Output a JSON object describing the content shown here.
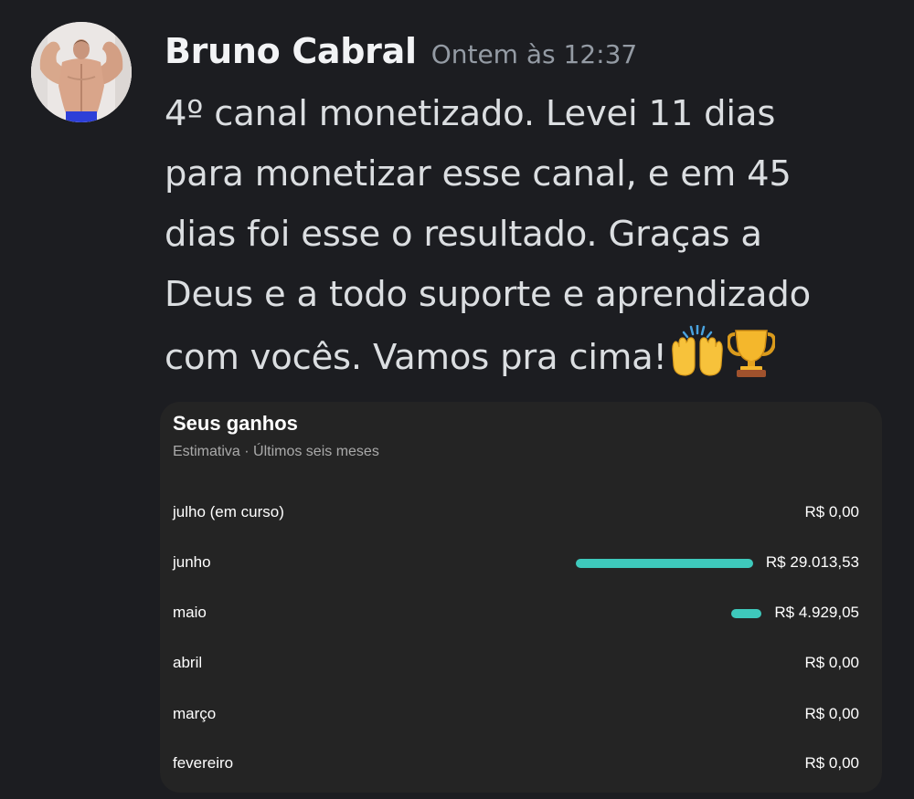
{
  "message": {
    "author": "Bruno Cabral",
    "timestamp": "Ontem às 12:37",
    "lines": [
      "4º canal monetizado. Levei 11 dias",
      "para monetizar esse canal, e em 45",
      "dias foi esse o resultado. Graças a",
      "Deus e a todo suporte e aprendizado",
      "com vocês. Vamos pra cima!"
    ],
    "emojis": [
      "raising-hands-icon",
      "trophy-icon"
    ]
  },
  "earnings_card": {
    "title": "Seus ganhos",
    "subtitle": "Estimativa · Últimos seis meses",
    "accent_color": "#3ec9bc",
    "rows": [
      {
        "month": "julho (em curso)",
        "amount": "R$ 0,00",
        "value": 0
      },
      {
        "month": "junho",
        "amount": "R$ 29.013,53",
        "value": 29013.53
      },
      {
        "month": "maio",
        "amount": "R$ 4.929,05",
        "value": 4929.05
      },
      {
        "month": "abril",
        "amount": "R$ 0,00",
        "value": 0
      },
      {
        "month": "março",
        "amount": "R$ 0,00",
        "value": 0
      },
      {
        "month": "fevereiro",
        "amount": "R$ 0,00",
        "value": 0
      }
    ]
  }
}
